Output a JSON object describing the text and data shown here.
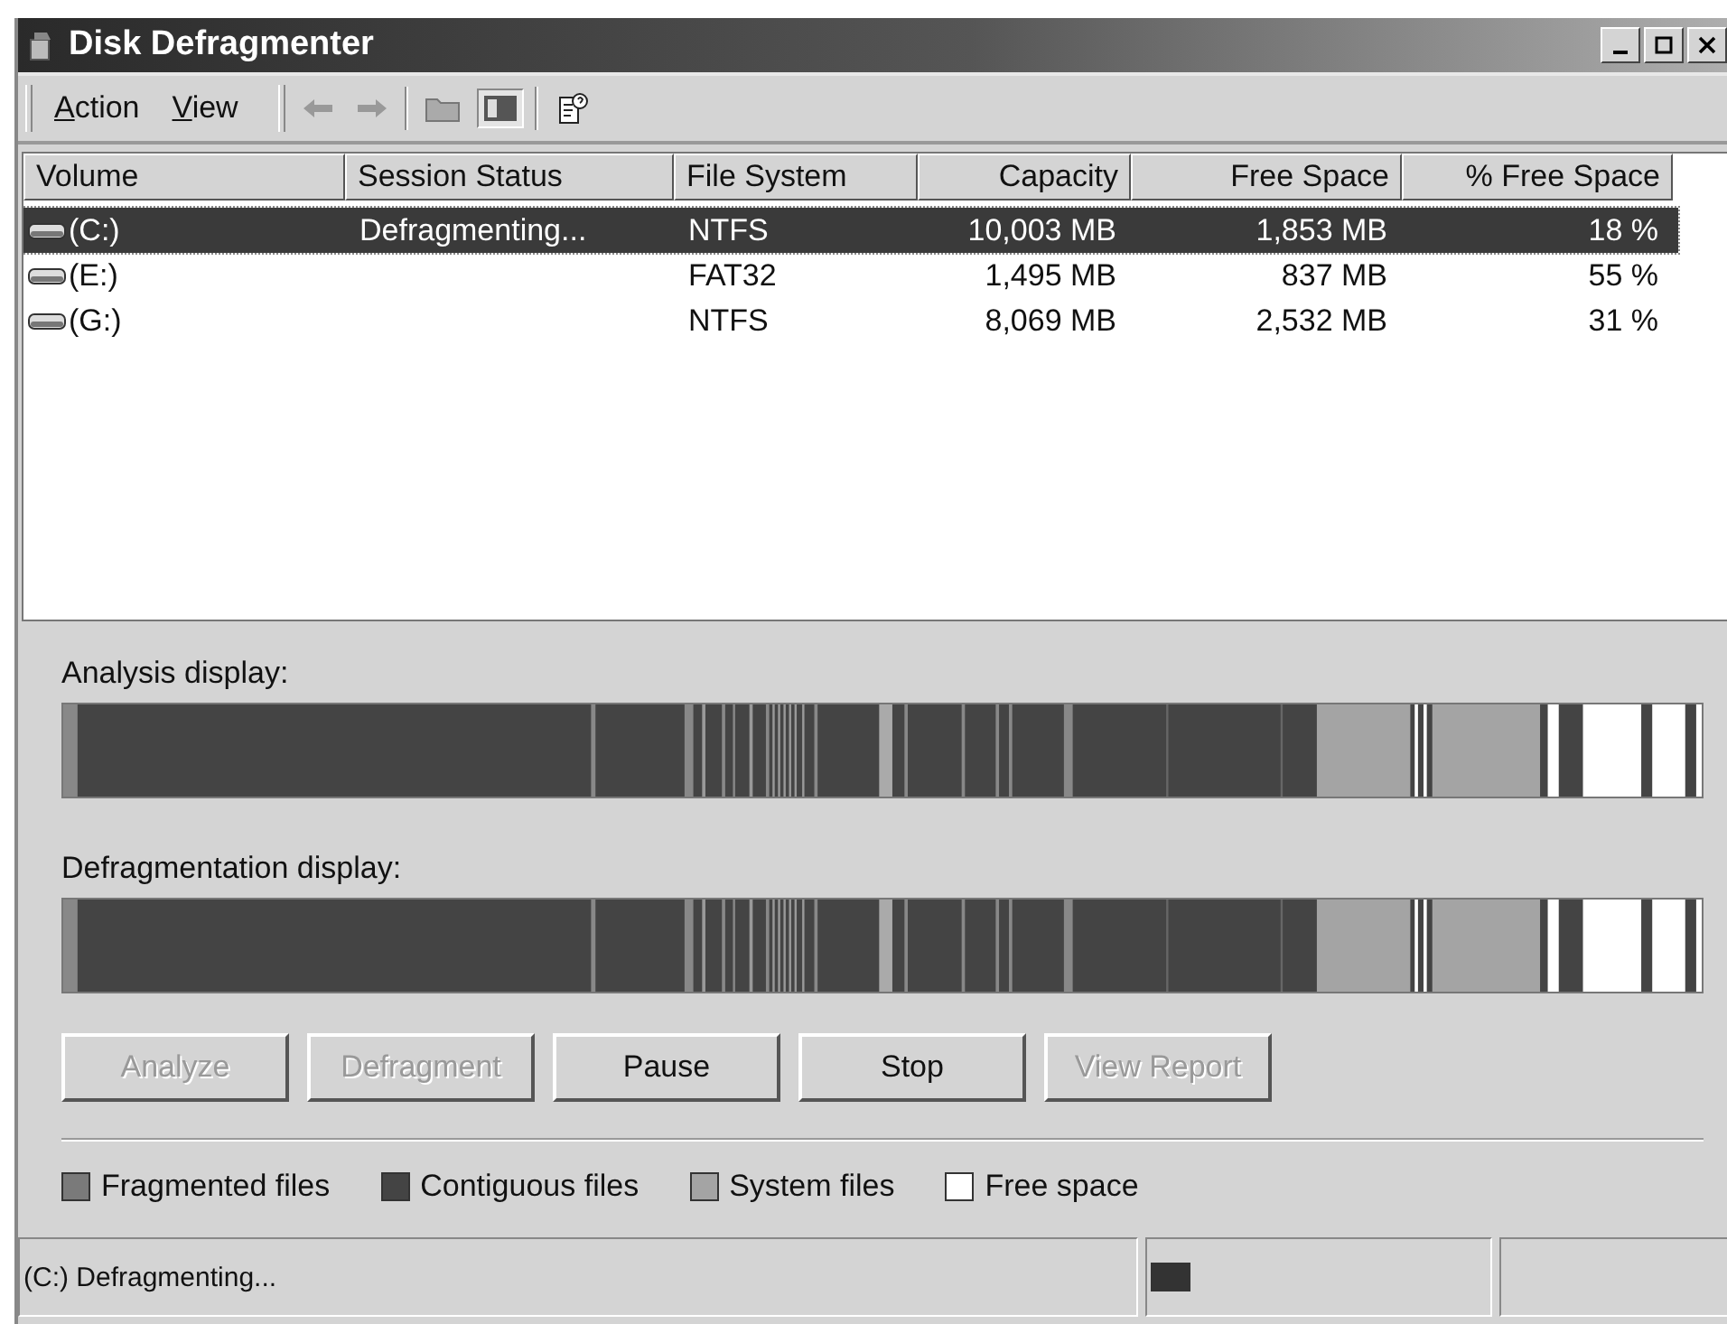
{
  "window": {
    "title": "Disk Defragmenter"
  },
  "menu": [
    {
      "label": "Action"
    },
    {
      "label": "View"
    }
  ],
  "table": {
    "columns": [
      {
        "label": "Volume"
      },
      {
        "label": "Session Status"
      },
      {
        "label": "File System"
      },
      {
        "label": "Capacity"
      },
      {
        "label": "Free Space"
      },
      {
        "label": "% Free Space"
      }
    ],
    "rows": [
      {
        "selected": true,
        "cells": [
          "(C:)",
          "Defragmenting...",
          "NTFS",
          "10,003 MB",
          "1,853 MB",
          "18 %"
        ]
      },
      {
        "selected": false,
        "cells": [
          "(E:)",
          "",
          "FAT32",
          "1,495 MB",
          "837 MB",
          "55 %"
        ]
      },
      {
        "selected": false,
        "cells": [
          "(G:)",
          "",
          "NTFS",
          "8,069 MB",
          "2,532 MB",
          "31 %"
        ]
      }
    ]
  },
  "displays": [
    {
      "label": "Analysis display:"
    },
    {
      "label": "Defragmentation display:"
    }
  ],
  "buttons": [
    {
      "label": "Analyze",
      "disabled": true
    },
    {
      "label": "Defragment",
      "disabled": true
    },
    {
      "label": "Pause",
      "disabled": false
    },
    {
      "label": "Stop",
      "disabled": false
    },
    {
      "label": "View Report",
      "disabled": true
    }
  ],
  "legend": [
    {
      "label": "Fragmented files",
      "color": "#7a7a7a"
    },
    {
      "label": "Contiguous files",
      "color": "#444444"
    },
    {
      "label": "System files",
      "color": "#a4a4a4"
    },
    {
      "label": "Free space",
      "color": "#ffffff"
    }
  ],
  "status_bar": {
    "text": "(C:) Defragmenting...",
    "progress": {
      "level": 0.12
    }
  }
}
